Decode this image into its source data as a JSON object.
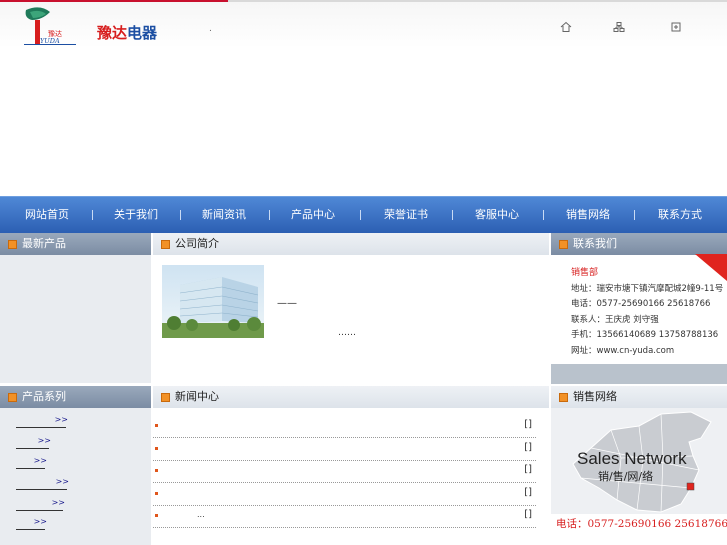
{
  "brand": {
    "logo_text": "豫达",
    "logo_sub": "YUDA",
    "name_red": "豫达",
    "name_blue": "电器",
    "dot": "."
  },
  "header_icons": [
    "home-icon",
    "sitemap-icon",
    "favorite-icon"
  ],
  "nav": [
    "网站首页",
    "关于我们",
    "新闻资讯",
    "产品中心",
    "荣誉证书",
    "客服中心",
    "销售网络",
    "联系方式"
  ],
  "sections": {
    "latest_products": "最新产品",
    "company_intro": "公司简介",
    "contact_us": "联系我们",
    "product_series": "产品系列",
    "news_center": "新闻中心",
    "sales_network": "销售网络"
  },
  "intro": {
    "dash": "——",
    "more": "……"
  },
  "contact": {
    "dept": "销售部",
    "address": "地址：瑞安市塘下镇汽摩配城2幢9-11号",
    "phone": "电话：0577-25690166  25618766",
    "person": "联系人：王庆虎  刘守强",
    "mobile": "手机：13566140689  13758788136",
    "site": "网址：www.cn-yuda.com"
  },
  "product_links": [
    ">>",
    ">>",
    ">>",
    ">>",
    ">>",
    ">>"
  ],
  "news": [
    {
      "text": "",
      "bracket": "[]"
    },
    {
      "text": "",
      "bracket": "[]"
    },
    {
      "text": "",
      "bracket": "[]"
    },
    {
      "text": "",
      "bracket": "[]"
    },
    {
      "text": "...",
      "bracket": "[]"
    }
  ],
  "map": {
    "title_en": "Sales Network",
    "title_cn": "销/售/网/络",
    "tel": "电话：0577-25690166  25618766"
  },
  "colors": {
    "nav": "#3d74c7",
    "accent_red": "#d71e1e",
    "brand_blue": "#1c4fa3"
  }
}
